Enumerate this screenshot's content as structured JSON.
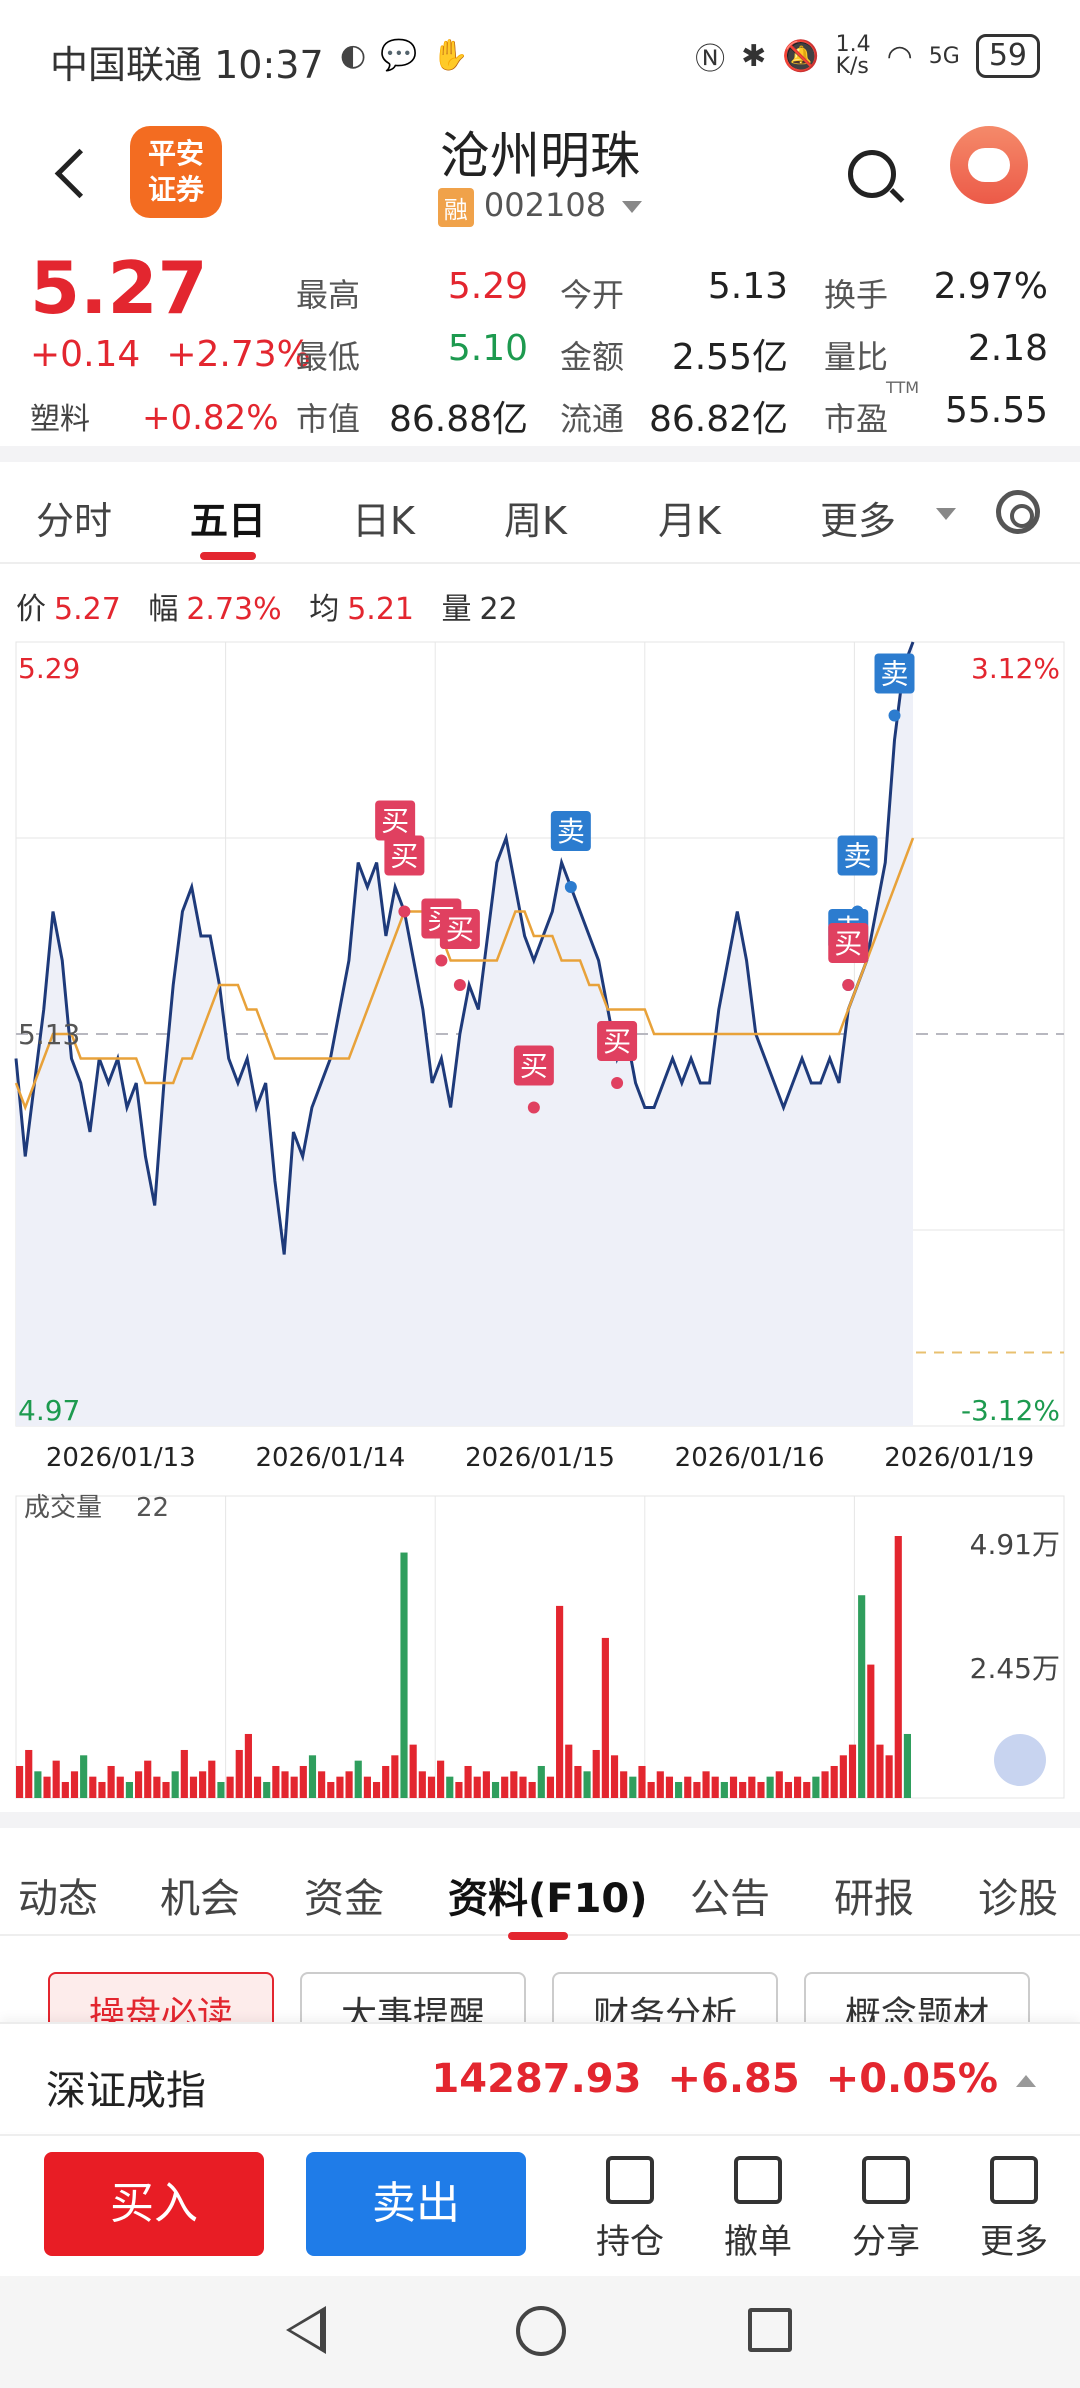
{
  "status_bar": {
    "carrier": "中国联通",
    "time": "10:37",
    "net_speed": "1.4\nK/s",
    "signal": "5G",
    "battery": "59"
  },
  "header": {
    "back_label": "<",
    "logo_text": "平安\n证券",
    "stock_name": "沧州明珠",
    "rong_badge": "融",
    "stock_code": "002108"
  },
  "quote": {
    "price": "5.27",
    "change": "+0.14",
    "change_pct": "+2.73%",
    "sector_label": "塑料",
    "sector_pct": "+0.82%",
    "fields": [
      {
        "label": "最高",
        "value": "5.29",
        "color": "red"
      },
      {
        "label": "今开",
        "value": "5.13",
        "color": "black"
      },
      {
        "label": "换手",
        "value": "2.97%",
        "color": "black"
      },
      {
        "label": "最低",
        "value": "5.10",
        "color": "green"
      },
      {
        "label": "金额",
        "value": "2.55亿",
        "color": "black"
      },
      {
        "label": "量比",
        "value": "2.18",
        "color": "black"
      },
      {
        "label": "市值",
        "value": "86.88亿",
        "color": "black"
      },
      {
        "label": "流通",
        "value": "86.82亿",
        "color": "black"
      },
      {
        "label": "市盈",
        "value": "55.55",
        "color": "black",
        "sup": "TTM"
      }
    ]
  },
  "chart_tabs": [
    "分时",
    "五日",
    "日K",
    "周K",
    "月K",
    "更多"
  ],
  "chart_tabs_active": 1,
  "info_line": {
    "price_label": "价",
    "price": "5.27",
    "amp_label": "幅",
    "amp": "2.73%",
    "avg_label": "均",
    "avg": "5.21",
    "vol_label": "量",
    "vol": "22"
  },
  "chart_data": {
    "type": "line",
    "title": "",
    "x_tick_labels": [
      "2026/01/13",
      "2026/01/14",
      "2026/01/15",
      "2026/01/16",
      "2026/01/19"
    ],
    "ylim": [
      4.97,
      5.29
    ],
    "y_left_labels": {
      "top": "5.29",
      "mid": "5.13",
      "bottom": "4.97"
    },
    "y_right_labels": {
      "top": "3.12%",
      "bottom": "-3.12%"
    },
    "prev_close": 5.13,
    "series": [
      {
        "name": "价",
        "color": "#1e3a7a",
        "values": [
          5.12,
          5.08,
          5.11,
          5.14,
          5.18,
          5.16,
          5.12,
          5.11,
          5.09,
          5.12,
          5.11,
          5.12,
          5.1,
          5.11,
          5.08,
          5.06,
          5.11,
          5.15,
          5.18,
          5.19,
          5.17,
          5.17,
          5.15,
          5.12,
          5.11,
          5.12,
          5.1,
          5.11,
          5.07,
          5.04,
          5.09,
          5.08,
          5.1,
          5.11,
          5.12,
          5.14,
          5.16,
          5.2,
          5.19,
          5.2,
          5.17,
          5.19,
          5.18,
          5.16,
          5.14,
          5.11,
          5.12,
          5.1,
          5.13,
          5.15,
          5.14,
          5.17,
          5.2,
          5.21,
          5.19,
          5.17,
          5.16,
          5.17,
          5.18,
          5.2,
          5.19,
          5.18,
          5.17,
          5.16,
          5.14,
          5.12,
          5.13,
          5.11,
          5.1,
          5.1,
          5.11,
          5.12,
          5.11,
          5.12,
          5.11,
          5.11,
          5.14,
          5.16,
          5.18,
          5.16,
          5.13,
          5.12,
          5.11,
          5.1,
          5.11,
          5.12,
          5.11,
          5.11,
          5.12,
          5.11,
          5.14,
          5.15,
          5.16,
          5.18,
          5.2,
          5.25,
          5.28,
          5.29
        ],
        "x_split_per_day": 20
      },
      {
        "name": "均",
        "color": "#e8a23a",
        "values": [
          5.11,
          5.1,
          5.11,
          5.12,
          5.13,
          5.13,
          5.13,
          5.12,
          5.12,
          5.12,
          5.12,
          5.12,
          5.12,
          5.12,
          5.11,
          5.11,
          5.11,
          5.11,
          5.12,
          5.12,
          5.13,
          5.14,
          5.15,
          5.15,
          5.15,
          5.14,
          5.14,
          5.13,
          5.12,
          5.12,
          5.12,
          5.12,
          5.12,
          5.12,
          5.12,
          5.12,
          5.12,
          5.13,
          5.14,
          5.15,
          5.16,
          5.17,
          5.18,
          5.18,
          5.18,
          5.17,
          5.17,
          5.16,
          5.16,
          5.16,
          5.16,
          5.16,
          5.16,
          5.17,
          5.18,
          5.18,
          5.17,
          5.17,
          5.17,
          5.16,
          5.16,
          5.16,
          5.15,
          5.15,
          5.14,
          5.14,
          5.14,
          5.14,
          5.14,
          5.13,
          5.13,
          5.13,
          5.13,
          5.13,
          5.13,
          5.13,
          5.13,
          5.13,
          5.13,
          5.13,
          5.13,
          5.13,
          5.13,
          5.13,
          5.13,
          5.13,
          5.13,
          5.13,
          5.13,
          5.13,
          5.14,
          5.15,
          5.16,
          5.17,
          5.18,
          5.19,
          5.2,
          5.21
        ]
      }
    ],
    "markers": [
      {
        "label": "买",
        "kind": "buy",
        "index": 41,
        "value": 5.2
      },
      {
        "label": "买",
        "kind": "buy",
        "index": 42,
        "value": 5.18
      },
      {
        "label": "买",
        "kind": "buy",
        "index": 46,
        "value": 5.16
      },
      {
        "label": "买",
        "kind": "buy",
        "index": 48,
        "value": 5.15
      },
      {
        "label": "买",
        "kind": "buy",
        "index": 56,
        "value": 5.1
      },
      {
        "label": "卖",
        "kind": "sell",
        "index": 60,
        "value": 5.19
      },
      {
        "label": "买",
        "kind": "buy",
        "index": 65,
        "value": 5.11
      },
      {
        "label": "卖",
        "kind": "sell",
        "index": 90,
        "value": 5.15
      },
      {
        "label": "买",
        "kind": "buy",
        "index": 90,
        "value": 5.15
      },
      {
        "label": "卖",
        "kind": "sell",
        "index": 91,
        "value": 5.18
      },
      {
        "label": "卖",
        "kind": "sell",
        "index": 95,
        "value": 5.26
      }
    ],
    "volume": {
      "label": "成交量",
      "value": "22",
      "ticks": {
        "top": "4.91万",
        "mid": "2.45万"
      },
      "ylim": [
        0,
        4.91
      ],
      "values": [
        0.6,
        0.9,
        0.5,
        0.4,
        0.7,
        0.3,
        0.5,
        0.8,
        0.4,
        0.3,
        0.6,
        0.4,
        0.3,
        0.5,
        0.7,
        0.4,
        0.3,
        0.5,
        0.9,
        0.4,
        0.5,
        0.7,
        0.3,
        0.4,
        0.9,
        1.2,
        0.4,
        0.3,
        0.6,
        0.5,
        0.4,
        0.6,
        0.8,
        0.5,
        0.3,
        0.4,
        0.5,
        0.7,
        0.4,
        0.3,
        0.6,
        0.8,
        4.6,
        1.0,
        0.5,
        0.4,
        0.7,
        0.4,
        0.3,
        0.6,
        0.4,
        0.5,
        0.3,
        0.4,
        0.5,
        0.4,
        0.3,
        0.6,
        0.4,
        3.6,
        1.0,
        0.6,
        0.5,
        0.9,
        3.0,
        0.8,
        0.5,
        0.4,
        0.6,
        0.3,
        0.5,
        0.4,
        0.3,
        0.4,
        0.3,
        0.5,
        0.4,
        0.3,
        0.4,
        0.3,
        0.4,
        0.3,
        0.4,
        0.5,
        0.3,
        0.4,
        0.3,
        0.4,
        0.5,
        0.6,
        0.8,
        1.0,
        3.8,
        2.5,
        1.0,
        0.8,
        4.91,
        1.2
      ],
      "colors": "mixed"
    }
  },
  "lower_tabs": [
    "动态",
    "机会",
    "资金",
    "资料(F10)",
    "公告",
    "研报",
    "诊股"
  ],
  "lower_tabs_active": 3,
  "chips": [
    "操盘必读",
    "大事提醒",
    "财务分析",
    "概念题材"
  ],
  "index_bar": {
    "name": "深证成指",
    "value": "14287.93",
    "change": "+6.85",
    "pct": "+0.05%"
  },
  "actions": {
    "buy": "买入",
    "sell": "卖出",
    "items": [
      "持仓",
      "撤单",
      "分享",
      "更多"
    ]
  }
}
